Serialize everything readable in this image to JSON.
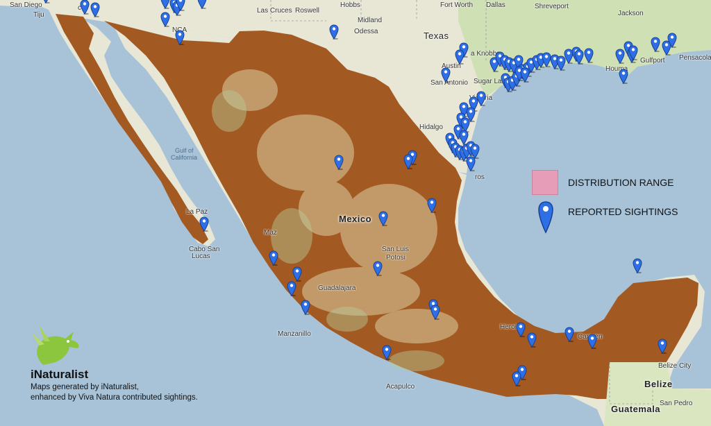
{
  "legend": {
    "distribution_label": "DISTRIBUTION RANGE",
    "sightings_label": "REPORTED SIGHTINGS",
    "range_color": "#e69db8",
    "pin_color": "#2f6fe6"
  },
  "brand": {
    "name": "iNaturalist",
    "caption_line1": "Maps generated by iNaturalist,",
    "caption_line2": "enhanced by Viva Natura contributed sightings.",
    "logo_icon": "green-bird-icon"
  },
  "map": {
    "range_fill": "#a35a22",
    "land_color": "#e8e7d6",
    "water_color": "#a8c3d8",
    "places": {
      "san_diego": "San Diego",
      "tijuana": "Tiju",
      "mexicali": "cali",
      "las_cruces": "Las Cruces",
      "roswell": "Roswell",
      "hobbs": "Hobbs",
      "midland": "Midland",
      "odessa": "Odessa",
      "fort_worth": "Fort Worth",
      "dallas": "Dallas",
      "shreveport": "Shreveport",
      "jackson": "Jackson",
      "texas": "Texas",
      "austin": "Austin",
      "san_antonio": "San Antonio",
      "sugar_land": "Sugar Land",
      "victoria": "Victoria",
      "houma": "Houma",
      "gulfport": "Gulfport",
      "pensacola": "Pensacola",
      "knobbs": "a Knobbs",
      "gulf_of_california_1": "Gulf of",
      "gulf_of_california_2": "California",
      "la_paz": "La Paz",
      "cabo_1": "Cabo San",
      "cabo_2": "Lucas",
      "mexico": "Mexico",
      "san_luis_1": "San Luis",
      "san_luis_2": "Potosi",
      "guadalajara": "Guadalajara",
      "manzanillo": "Manzanillo",
      "acapulco": "Acapulco",
      "heroica": "Heroica",
      "carmen": "Carmen",
      "belize_city": "Belize City",
      "belize": "Belize",
      "guatemala": "Guatemala",
      "san_pedro": "San Pedro",
      "nca": "NCA",
      "mazatlan": "Maz",
      "hidalgo": "Hidalgo",
      "ros": "ros"
    }
  },
  "sightings": [
    [
      66,
      4
    ],
    [
      122,
      20
    ],
    [
      137,
      24
    ],
    [
      238,
      12
    ],
    [
      251,
      18
    ],
    [
      255,
      22
    ],
    [
      260,
      15
    ],
    [
      291,
      12
    ],
    [
      238,
      38
    ],
    [
      259,
      64
    ],
    [
      481,
      56
    ],
    [
      668,
      82
    ],
    [
      662,
      92
    ],
    [
      642,
      118
    ],
    [
      712,
      103
    ],
    [
      720,
      95
    ],
    [
      727,
      100
    ],
    [
      733,
      103
    ],
    [
      740,
      105
    ],
    [
      747,
      100
    ],
    [
      752,
      113
    ],
    [
      760,
      110
    ],
    [
      765,
      104
    ],
    [
      773,
      100
    ],
    [
      779,
      97
    ],
    [
      787,
      96
    ],
    [
      799,
      99
    ],
    [
      808,
      101
    ],
    [
      819,
      91
    ],
    [
      830,
      88
    ],
    [
      834,
      92
    ],
    [
      848,
      90
    ],
    [
      893,
      91
    ],
    [
      905,
      80
    ],
    [
      910,
      90
    ],
    [
      912,
      86
    ],
    [
      944,
      74
    ],
    [
      960,
      79
    ],
    [
      968,
      68
    ],
    [
      898,
      120
    ],
    [
      728,
      126
    ],
    [
      732,
      132
    ],
    [
      738,
      130
    ],
    [
      744,
      124
    ],
    [
      748,
      116
    ],
    [
      756,
      118
    ],
    [
      693,
      152
    ],
    [
      682,
      160
    ],
    [
      668,
      168
    ],
    [
      678,
      175
    ],
    [
      664,
      183
    ],
    [
      670,
      190
    ],
    [
      660,
      200
    ],
    [
      668,
      208
    ],
    [
      648,
      212
    ],
    [
      652,
      220
    ],
    [
      656,
      226
    ],
    [
      662,
      230
    ],
    [
      668,
      232
    ],
    [
      672,
      228
    ],
    [
      678,
      224
    ],
    [
      684,
      228
    ],
    [
      678,
      246
    ],
    [
      594,
      237
    ],
    [
      588,
      243
    ],
    [
      488,
      244
    ],
    [
      622,
      306
    ],
    [
      552,
      325
    ],
    [
      294,
      333
    ],
    [
      394,
      382
    ],
    [
      544,
      397
    ],
    [
      428,
      405
    ],
    [
      420,
      426
    ],
    [
      440,
      453
    ],
    [
      624,
      452
    ],
    [
      627,
      460
    ],
    [
      557,
      518
    ],
    [
      750,
      485
    ],
    [
      766,
      500
    ],
    [
      820,
      492
    ],
    [
      853,
      502
    ],
    [
      918,
      393
    ],
    [
      954,
      509
    ],
    [
      752,
      547
    ],
    [
      744,
      556
    ]
  ]
}
